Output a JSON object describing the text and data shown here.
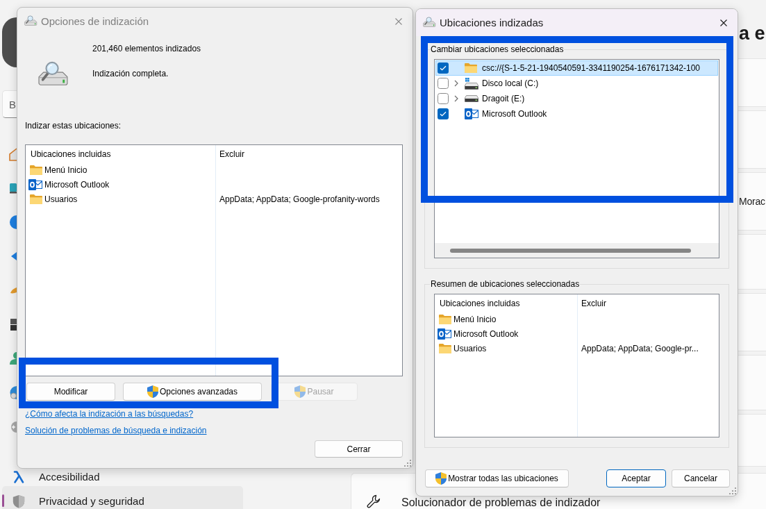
{
  "settings_window": {
    "search": {
      "placeholder": "B"
    },
    "nav_items": [
      {
        "kind": "accessibility",
        "label": "Accesibilidad",
        "selected": false
      },
      {
        "kind": "privacy",
        "label": "Privacidad y seguridad",
        "selected": true
      }
    ],
    "page_heading": "a e",
    "card_label": "Morac",
    "troubleshooter_card": {
      "label": "Solucionador de problemas de indizador"
    }
  },
  "indexing_options": {
    "title": "Opciones de indización",
    "active": false,
    "item_count": "201,460 elementos indizados",
    "status": "Indización completa.",
    "locations_label": "Indizar estas ubicaciones:",
    "table": {
      "columns": [
        "Ubicaciones incluidas",
        "Excluir"
      ],
      "rows": [
        {
          "kind": "folder",
          "location": "Menú Inicio"
        },
        {
          "kind": "mail",
          "location": "Microsoft Outlook"
        },
        {
          "kind": "folder",
          "location": "Usuarios",
          "exclude": "AppData; AppData; Google-profanity-words"
        }
      ]
    },
    "buttons": [
      {
        "label": "Modificar",
        "shield": false,
        "disabled": false
      },
      {
        "label": "Opciones avanzadas",
        "shield": true,
        "disabled": false
      },
      {
        "label": "Pausar",
        "shield": true,
        "disabled": true
      }
    ],
    "buttons_highlighted": true,
    "links": [
      "¿Cómo afecta la indización a las búsquedas?",
      "Solución de problemas de búsqueda e indización"
    ],
    "close_button": "Cerrar"
  },
  "indexed_locations": {
    "title": "Ubicaciones indizadas",
    "active": true,
    "change_group": {
      "legend": "Cambiar ubicaciones seleccionadas",
      "highlighted": true,
      "tree": [
        {
          "kind": "folder",
          "label": "csc://{S-1-5-21-1940540591-3341190254-1676171342-100",
          "checked": true,
          "selected": true,
          "expandable": false
        },
        {
          "kind": "system-drive",
          "label": "Disco local (C:)",
          "checked": false,
          "selected": false,
          "expandable": true
        },
        {
          "kind": "drive",
          "label": "Dragoit (E:)",
          "checked": false,
          "selected": false,
          "expandable": true
        },
        {
          "kind": "mail",
          "label": "Microsoft Outlook",
          "checked": true,
          "selected": false,
          "expandable": false
        }
      ]
    },
    "summary_group": {
      "legend": "Resumen de ubicaciones seleccionadas",
      "table": {
        "columns": [
          "Ubicaciones incluidas",
          "Excluir"
        ],
        "rows": [
          {
            "kind": "folder",
            "location": "Menú Inicio"
          },
          {
            "kind": "mail",
            "location": "Microsoft Outlook"
          },
          {
            "kind": "folder",
            "location": "Usuarios",
            "exclude": "AppData; AppData; Google-pr..."
          }
        ]
      }
    },
    "show_all_button": {
      "label": "Mostrar todas las ubicaciones",
      "shield": true
    },
    "footer_buttons": [
      {
        "label": "Aceptar",
        "default": true
      },
      {
        "label": "Cancelar",
        "default": false
      }
    ]
  }
}
